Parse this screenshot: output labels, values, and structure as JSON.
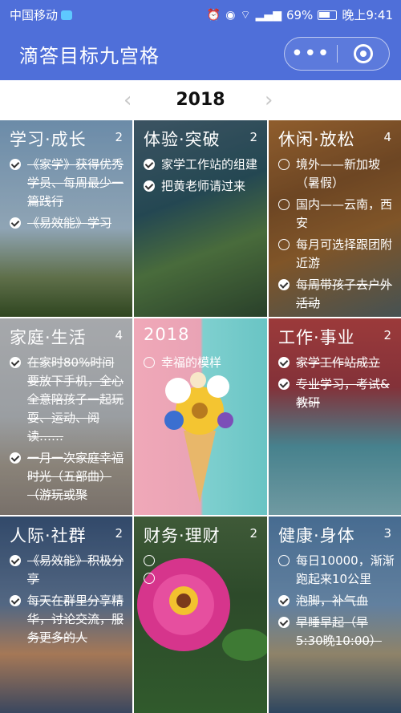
{
  "status_bar": {
    "carrier": "中国移动",
    "battery": "69%",
    "time": "晚上9:41"
  },
  "title_bar": {
    "title": "滴答目标九宫格"
  },
  "year_nav": {
    "year": "2018"
  },
  "grid": [
    {
      "title": "学习·成长",
      "count": "2",
      "goals": [
        {
          "text": "《家学》获得优秀学员、每周最少一篇践行",
          "done": true
        },
        {
          "text": "《易效能》学习",
          "done": true
        }
      ]
    },
    {
      "title": "体验·突破",
      "count": "2",
      "goals": [
        {
          "text": "家学工作站的组建",
          "done": true
        },
        {
          "text": "把黄老师请过来",
          "done": true
        }
      ]
    },
    {
      "title": "休闲·放松",
      "count": "4",
      "goals": [
        {
          "text": "境外——新加坡（暑假）",
          "done": false
        },
        {
          "text": "国内——云南，西安",
          "done": false
        },
        {
          "text": "每月可选择跟团附近游",
          "done": false
        },
        {
          "text": "每周带孩子去户外活动",
          "done": true
        }
      ]
    },
    {
      "title": "家庭·生活",
      "count": "4",
      "goals": [
        {
          "text": "在家时80%时间要放下手机，全心全意陪孩子一起玩耍、运动、阅读……",
          "done": true
        },
        {
          "text": "一月一次家庭幸福时光（五部曲）（游玩或聚",
          "done": true
        }
      ]
    },
    {
      "title": "2018",
      "count": "",
      "goals": [
        {
          "text": "幸福的模样",
          "done": false
        }
      ]
    },
    {
      "title": "工作·事业",
      "count": "2",
      "goals": [
        {
          "text": "家学工作站成立",
          "done": true
        },
        {
          "text": "专业学习，考试&教研",
          "done": true
        }
      ]
    },
    {
      "title": "人际·社群",
      "count": "2",
      "goals": [
        {
          "text": "《易效能》积极分享",
          "done": true
        },
        {
          "text": "每天在群里分享精华，讨论交流，服务更多的人",
          "done": true
        }
      ]
    },
    {
      "title": "财务·理财",
      "count": "2",
      "goals": [
        {
          "text": "",
          "done": false
        },
        {
          "text": "",
          "done": false
        }
      ]
    },
    {
      "title": "健康·身体",
      "count": "3",
      "goals": [
        {
          "text": "每日10000，渐渐跑起来10公里",
          "done": false
        },
        {
          "text": "泡脚，补气血",
          "done": true
        },
        {
          "text": "早睡早起（早5:30晚10:00）",
          "done": true
        }
      ]
    }
  ]
}
